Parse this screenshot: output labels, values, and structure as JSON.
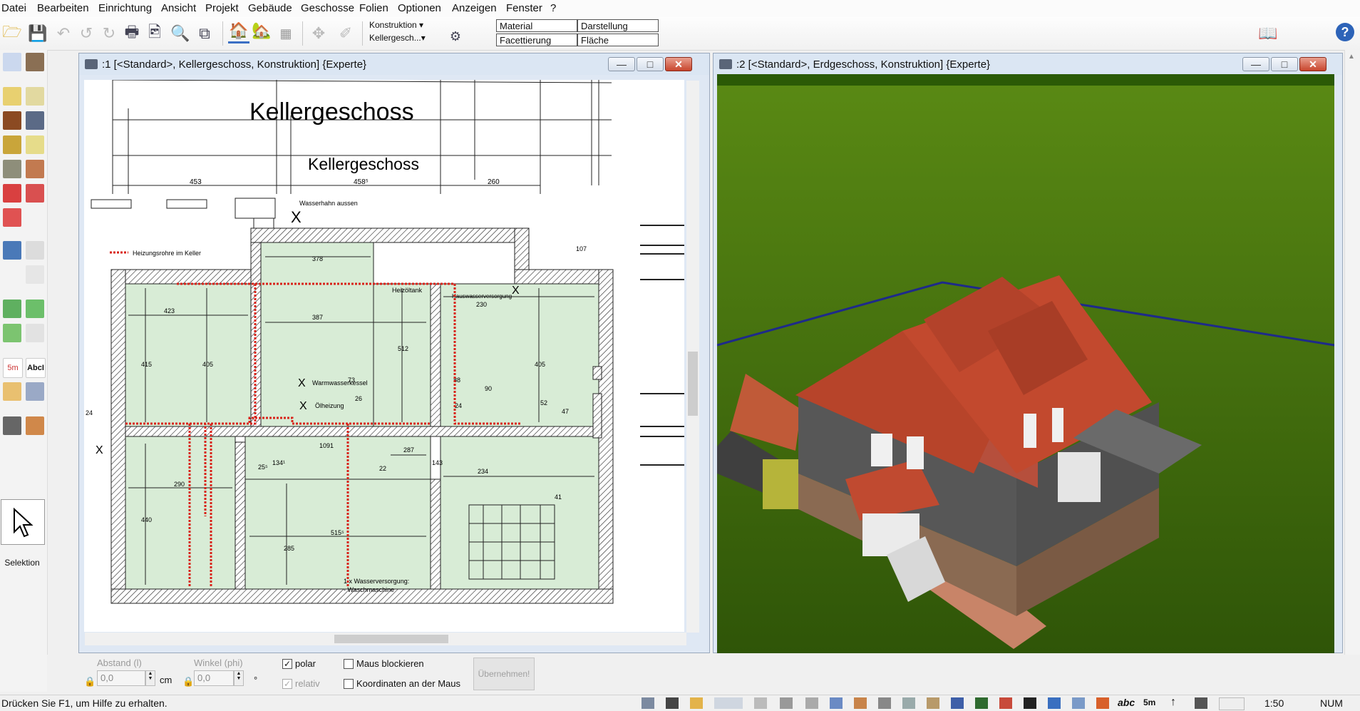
{
  "menu": [
    "Datei",
    "Bearbeiten",
    "Einrichtung",
    "Ansicht",
    "Projekt",
    "Gebäude",
    "Geschosse",
    "Folien",
    "Optionen",
    "Anzeigen",
    "Fenster",
    "?"
  ],
  "toolbar": {
    "konstruktion_dd": "Konstruktion ▾",
    "kellergeschoss_dd": "Kellergesch...▾",
    "props": [
      "Material",
      "Darstellung",
      "Facettierung",
      "Fläche"
    ]
  },
  "palette": {
    "selektion_label": "Selektion",
    "measure_glyph": "5m",
    "text_glyph": "AbcI"
  },
  "window1": {
    "title": ":1 [<Standard>, Kellergeschoss, Konstruktion] {Experte}",
    "plan_title": "Kellergeschoss",
    "plan_subtitle": "Kellergeschoss",
    "dims_top": [
      "453",
      "458⁵",
      "260"
    ],
    "labels": {
      "wasserhahn": "Wasserhahn aussen",
      "heizungsrohre": "Heizungsrohre im Keller",
      "heizoltank": "Heizöltank",
      "hauswasser": "Hauswasserversorgung",
      "warmwasser": "Warmwasserkessel",
      "olheizung": "Ölheizung",
      "wasserversorgung1": "1 x Wasserversorgung:",
      "wasserversorgung2": "- Waschmaschine",
      "x1": "X",
      "x2": "X",
      "x3": "X",
      "x4": "X",
      "x5": "X"
    },
    "dims": {
      "d378": "378",
      "d387": "387",
      "d512": "512",
      "d423": "423",
      "d415": "415",
      "d405a": "405",
      "d230": "230",
      "d405b": "405",
      "d73": "73",
      "d88": "88",
      "d90": "90",
      "d26": "26",
      "d24a": "24",
      "d1091": "1091",
      "d287": "287",
      "d143": "143",
      "d134": "134¹",
      "d25": "25⁵",
      "d22": "22",
      "d234": "234",
      "d290": "290",
      "d515": "515⁵",
      "d285": "285",
      "d440": "440",
      "d41": "41",
      "d47": "47",
      "d52": "52",
      "d107": "107",
      "d24b": "24"
    }
  },
  "window2": {
    "title": ":2 [<Standard>, Erdgeschoss, Konstruktion] {Experte}"
  },
  "bottom": {
    "abstand_label": "Abstand (l)",
    "abstand_value": "0,0",
    "abstand_unit": "cm",
    "winkel_label": "Winkel (phi)",
    "winkel_value": "0,0",
    "winkel_unit": "°",
    "polar_label": "polar",
    "relativ_label": "relativ",
    "maus_blockieren": "Maus blockieren",
    "koordinaten": "Koordinaten an der Maus",
    "apply": "Übernehmen!"
  },
  "status": {
    "help": "Drücken Sie F1, um Hilfe zu erhalten.",
    "scale": "1:50",
    "num": "NUM",
    "text_glyph": "abc",
    "measure_glyph": "5m"
  },
  "colors": {
    "room_fill": "#d8ecd6",
    "heating_pipe": "#d8241b",
    "lawn": "#3e6a0c",
    "roof": "#b7442a"
  }
}
